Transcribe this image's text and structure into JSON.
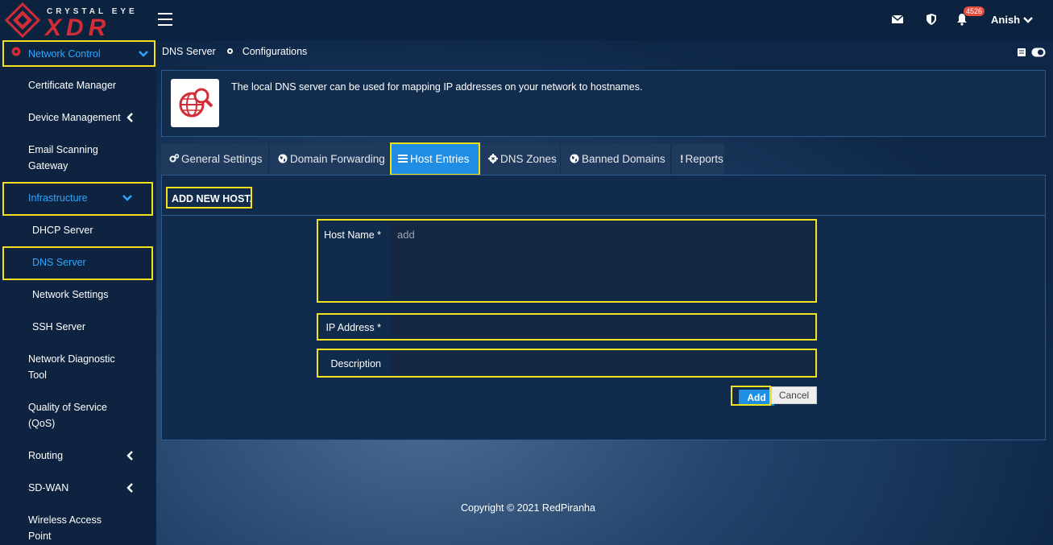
{
  "brand": {
    "top": "CRYSTAL EYE",
    "main": "XDR",
    "accent": "#d22c36"
  },
  "header": {
    "notifications_count": "4526",
    "user_name": "Anish"
  },
  "sidebar": {
    "items": [
      {
        "label": "Network Control"
      },
      {
        "label": "Certificate Manager"
      },
      {
        "label": "Device Management"
      },
      {
        "label": "Email Scanning",
        "label2": "Gateway"
      },
      {
        "label": "Infrastructure"
      },
      {
        "label": "DHCP Server"
      },
      {
        "label": "DNS Server"
      },
      {
        "label": "Network Settings"
      },
      {
        "label": "SSH Server"
      },
      {
        "label": "Network Diagnostic",
        "label2": "Tool"
      },
      {
        "label": "Quality of Service",
        "label2": "(QoS)"
      },
      {
        "label": "Routing"
      },
      {
        "label": "SD-WAN"
      },
      {
        "label": "Wireless Access",
        "label2": "Point"
      }
    ]
  },
  "breadcrumb": {
    "item1": "DNS Server",
    "item2": "Configurations"
  },
  "info": {
    "description": "The local DNS server can be used for mapping IP addresses on your network to hostnames."
  },
  "tabs": [
    {
      "label": "General Settings"
    },
    {
      "label": "Domain Forwarding"
    },
    {
      "label": "Host Entries"
    },
    {
      "label": "DNS Zones"
    },
    {
      "label": "Banned Domains"
    },
    {
      "label": "Reports"
    }
  ],
  "form": {
    "title": "ADD NEW HOST.",
    "host_name_label": "Host Name *",
    "host_name_placeholder": "add",
    "ip_label": "IP Address *",
    "description_label": "Description",
    "add_label": "Add",
    "cancel_label": "Cancel"
  },
  "footer": {
    "text": "Copyright © 2021 RedPiranha"
  },
  "colors": {
    "highlight": "#f3e21b",
    "active_tab": "#1f8de3",
    "active_link": "#2ea7ff"
  }
}
